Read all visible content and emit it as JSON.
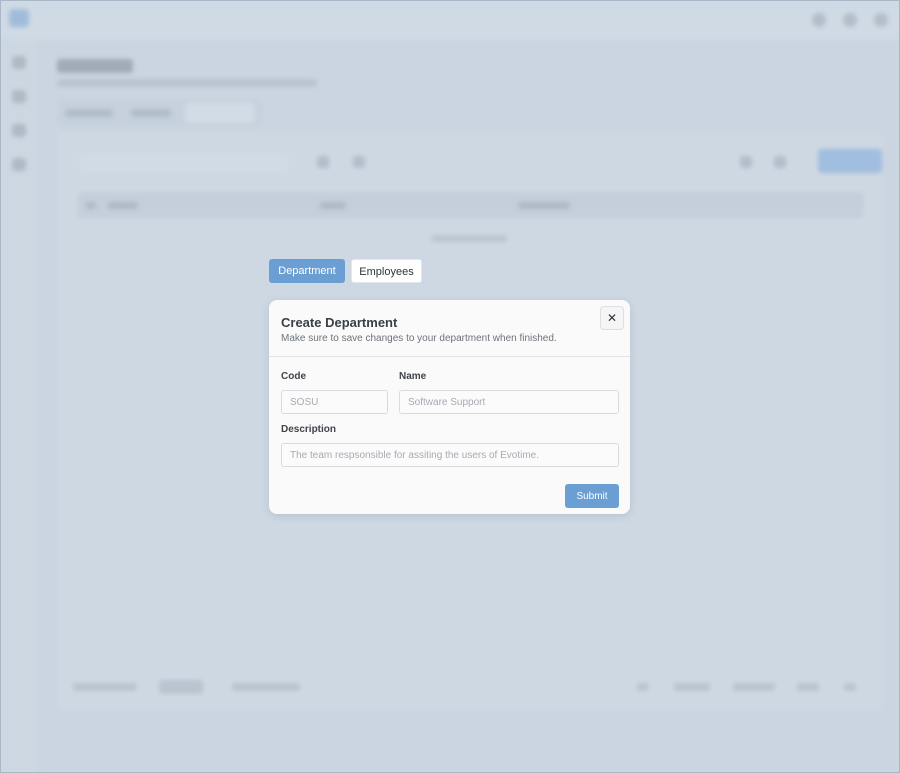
{
  "tabs": {
    "department_label": "Department",
    "employees_label": "Employees"
  },
  "modal": {
    "title": "Create Department",
    "subtitle": "Make sure to save changes to your department when finished.",
    "close_icon": "close-icon",
    "code": {
      "label": "Code",
      "placeholder": "SOSU"
    },
    "name": {
      "label": "Name",
      "placeholder": "Software Support"
    },
    "description": {
      "label": "Description",
      "placeholder": "The team respsonsible for assiting the users of Evotime."
    },
    "submit_label": "Submit"
  },
  "colors": {
    "accent": "#6b9ed3",
    "overlay": "#d2dbe4",
    "modal_background": "#fafafa"
  }
}
